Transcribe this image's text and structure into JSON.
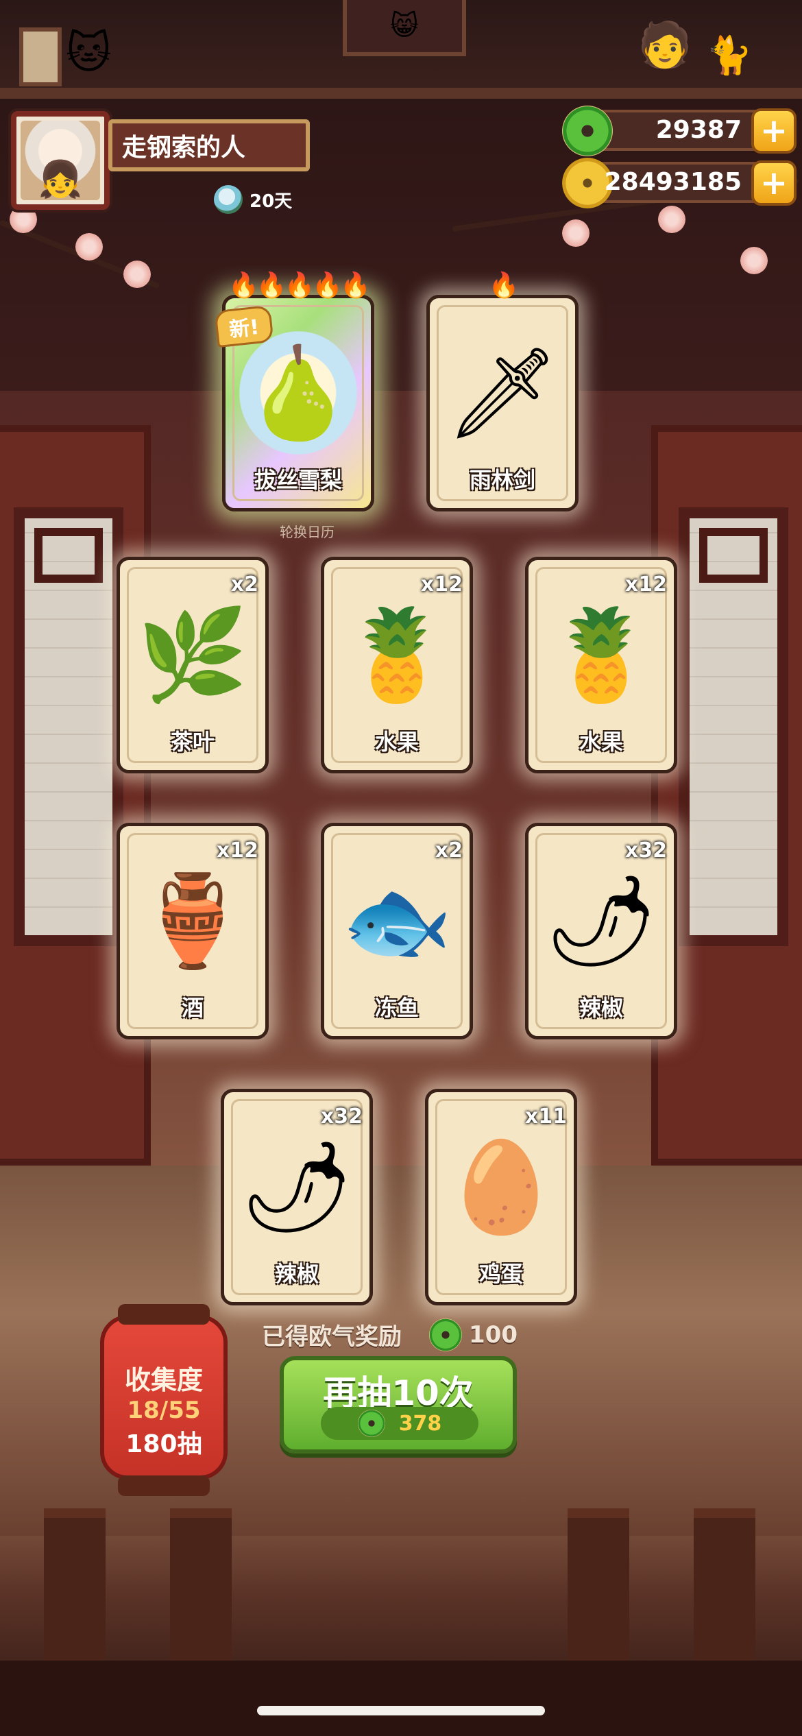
{
  "player": {
    "name": "走钢索的人",
    "days": "20天"
  },
  "currencies": {
    "jade": {
      "value": "29387",
      "plus": "+"
    },
    "gold": {
      "value": "28493185",
      "plus": "+"
    }
  },
  "sign_text": "轮换日历",
  "featured": [
    {
      "label": "拔丝雪梨",
      "badge": "新!",
      "fires": "🔥🔥🔥🔥🔥",
      "art": "🍐"
    },
    {
      "label": "雨林剑",
      "fires": "🔥",
      "art": "🗡"
    }
  ],
  "rows": [
    [
      {
        "label": "茶叶",
        "qty": "x2",
        "art": "🌿"
      },
      {
        "label": "水果",
        "qty": "x12",
        "art": "🍍"
      },
      {
        "label": "水果",
        "qty": "x12",
        "art": "🍍"
      }
    ],
    [
      {
        "label": "酒",
        "qty": "x12",
        "art": "🏺"
      },
      {
        "label": "冻鱼",
        "qty": "x2",
        "art": "🐟"
      },
      {
        "label": "辣椒",
        "qty": "x32",
        "art": "🌶"
      }
    ],
    [
      {
        "label": "辣椒",
        "qty": "x32",
        "art": "🌶"
      },
      {
        "label": "鸡蛋",
        "qty": "x11",
        "art": "🥚"
      }
    ]
  ],
  "reward": {
    "label": "已得欧气奖励",
    "value": "100"
  },
  "collection": {
    "title": "收集度",
    "progress": "18/55",
    "draws": "180抽"
  },
  "draw_button": {
    "label": "再抽10次",
    "cost": "378"
  },
  "colors": {
    "jade": "#59c13b",
    "gold": "#f3c63a",
    "button": "#6fbf35"
  }
}
